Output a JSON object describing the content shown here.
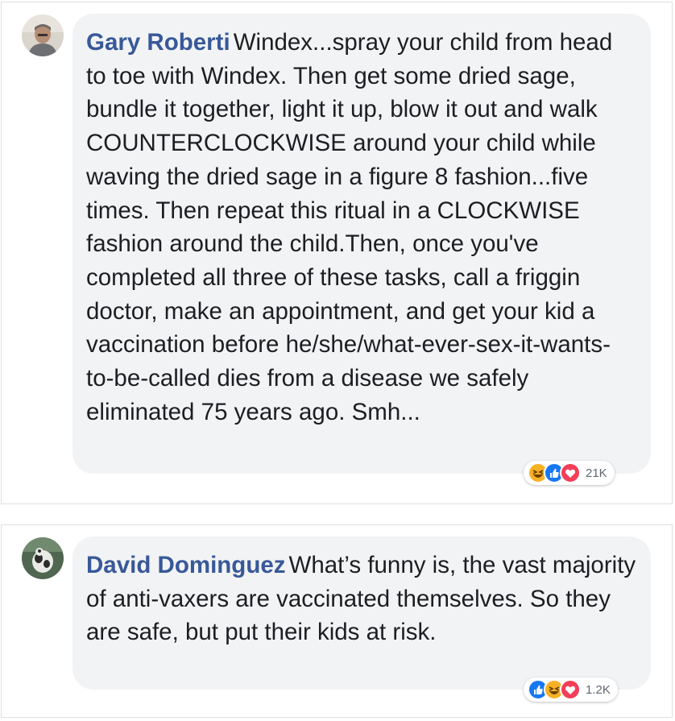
{
  "comments": [
    {
      "author": "Gary Roberti",
      "text": "Windex...spray your child from head to toe with Windex. Then get some dried sage, bundle it together, light it up, blow it out and walk COUNTERCLOCKWISE around your child while waving the dried sage in a figure 8 fashion...five times. Then repeat this ritual in a CLOCKWISE fashion around the child.Then, once you've completed all three of these tasks, call a friggin doctor, make an appointment, and get your kid a vaccination before he/she/what-ever-sex-it-wants-to-be-called dies from a disease we safely eliminated 75 years ago. Smh...",
      "reaction_icons": [
        "haha-icon",
        "like-icon",
        "love-icon"
      ],
      "reaction_count": "21K"
    },
    {
      "author": "David Dominguez",
      "text": "What’s funny is, the vast majority of anti-vaxers are vaccinated themselves. So they are safe, but put their kids at risk.",
      "reaction_icons": [
        "like-icon",
        "haha-icon",
        "love-icon"
      ],
      "reaction_count": "1.2K"
    }
  ],
  "colors": {
    "author_link": "#385898",
    "bubble_bg": "#f2f3f5",
    "text": "#1c1e21",
    "like": "#1877f2",
    "haha": "#f7b125",
    "love": "#f33e58"
  }
}
